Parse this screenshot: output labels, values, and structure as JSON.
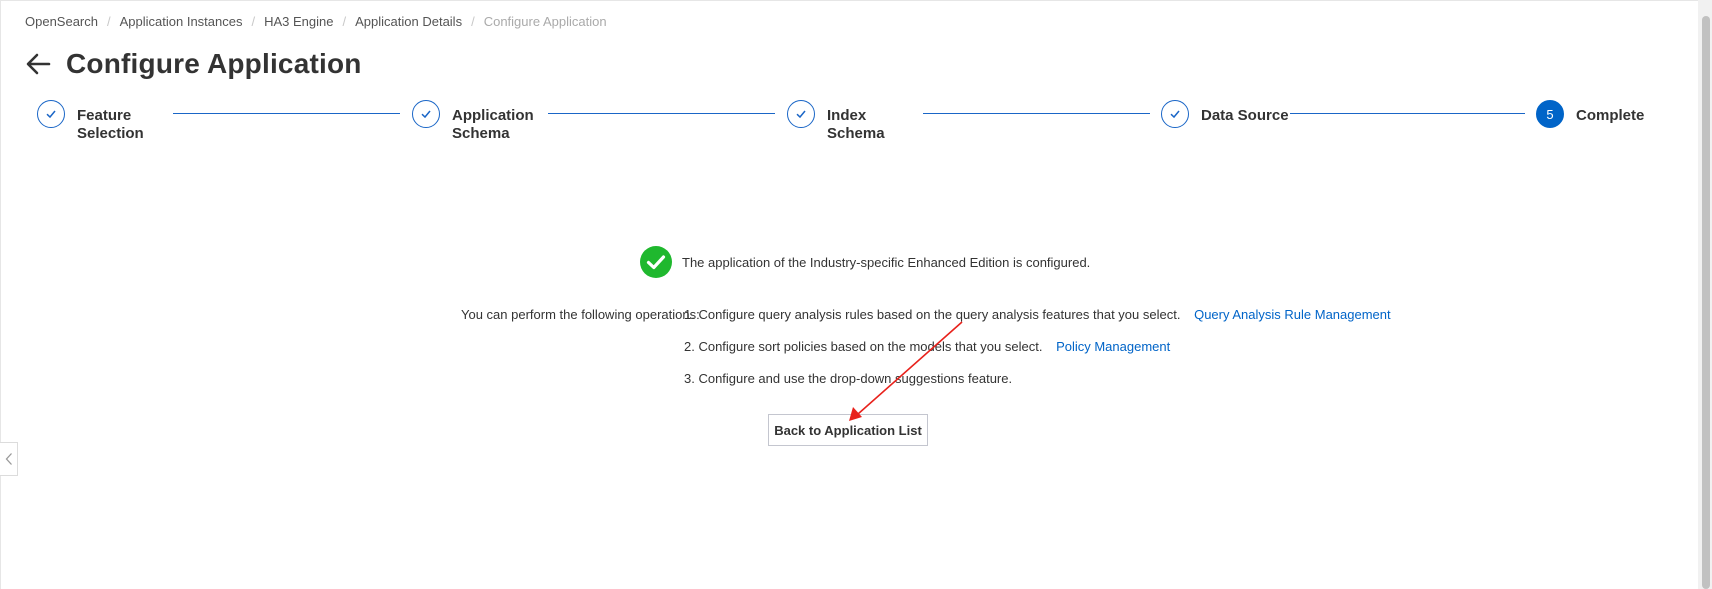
{
  "breadcrumb": [
    {
      "label": "OpenSearch"
    },
    {
      "label": "Application Instances"
    },
    {
      "label": "HA3 Engine"
    },
    {
      "label": "Application Details"
    },
    {
      "label": "Configure Application"
    }
  ],
  "page": {
    "title": "Configure Application"
  },
  "steps": [
    {
      "label": "Feature Selection",
      "status": "done"
    },
    {
      "label": "Application Schema",
      "status": "done"
    },
    {
      "label": "Index Schema",
      "status": "done"
    },
    {
      "label": "Data Source",
      "status": "done"
    },
    {
      "number": "5",
      "label": "Complete",
      "status": "active"
    }
  ],
  "result": {
    "message": "The application of the Industry-specific Enhanced Edition is configured."
  },
  "operations": {
    "intro": "You can perform the following operations:",
    "items": [
      {
        "text": "1. Configure query analysis rules based on the query analysis features that you select.",
        "link": "Query Analysis Rule Management"
      },
      {
        "text": "2. Configure sort policies based on the models that you select.",
        "link": "Policy Management"
      },
      {
        "text": "3. Configure and use the drop-down suggestions feature."
      }
    ]
  },
  "actions": {
    "back_label": "Back to Application List"
  },
  "colors": {
    "primary": "#0064c8",
    "success": "#1fb82e",
    "annotation": "#e8211b"
  },
  "icons": {
    "back": "arrow-left-icon",
    "step_done": "check-icon",
    "success": "check-circle-icon",
    "collapse": "chevron-left-icon"
  }
}
